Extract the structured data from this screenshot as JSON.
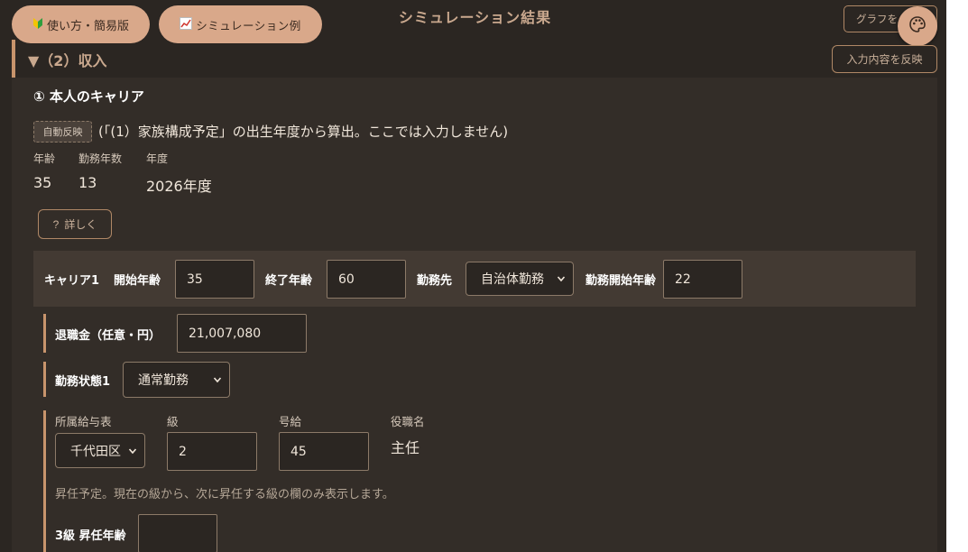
{
  "topbar": {
    "guide_icon": "beginner-leaf-icon",
    "guide_label": "使い方・簡易版",
    "example_icon": "chart-up-icon",
    "example_label": "シミュレーション例",
    "title": "シミュレーション結果",
    "graph_label": "グラフを",
    "palette_icon": "palette-icon",
    "reflect_label": "入力内容を反映"
  },
  "section": {
    "title": "▼（2）収入"
  },
  "career": {
    "heading": "① 本人のキャリア",
    "auto_badge": "自動反映",
    "auto_note": "(「(1）家族構成予定」の出生年度から算出。ここでは入力しません)",
    "stats": {
      "age_label": "年齢",
      "years_label": "勤務年数",
      "year_label": "年度",
      "age": "35",
      "years": "13",
      "year": "2026年度"
    },
    "detail_label": "詳しく",
    "row1": {
      "name": "キャリア1",
      "start_label": "開始年齢",
      "start_value": "35",
      "end_label": "終了年齢",
      "end_value": "60",
      "employer_label": "勤務先",
      "employer_value": "自治体勤務",
      "work_start_label": "勤務開始年齢",
      "work_start_value": "22"
    },
    "retirement": {
      "label": "退職金（任意・円）",
      "value": "21,007,080"
    },
    "work_status": {
      "label": "勤務状態1",
      "value": "通常勤務"
    },
    "salary": {
      "table_label": "所属給与表",
      "table_value": "千代田区",
      "grade_label": "級",
      "grade_value": "2",
      "step_label": "号給",
      "step_value": "45",
      "position_label": "役職名",
      "position_value": "主任"
    },
    "promotion_note": "昇任予定。現在の級から、次に昇任する級の欄のみ表示します。",
    "promotion": {
      "label": "3級 昇任年齢",
      "value": ""
    }
  },
  "colors": {
    "background": "#2b2622",
    "panel": "#332d28",
    "accent": "#c8946c",
    "pill": "#d9a88a"
  }
}
